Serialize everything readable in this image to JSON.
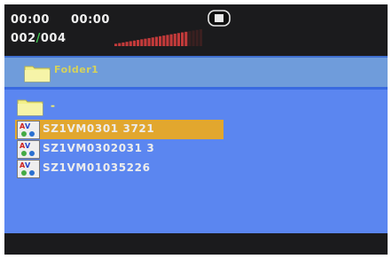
{
  "header": {
    "time_elapsed": "00:00",
    "time_total": "00:00",
    "track_current": "002",
    "track_separator": "/",
    "track_total": "004",
    "volume_level": 0.85,
    "stop_icon": "stop-icon"
  },
  "current_folder": {
    "icon": "folder-icon",
    "name": "Folder1"
  },
  "file_list": {
    "parent_icon": "folder-icon",
    "parent_label": "-",
    "items": [
      {
        "name": "SZ1VM0301 3721",
        "icon": "video-file-icon",
        "selected": true
      },
      {
        "name": "SZ1VM0302031 3",
        "icon": "video-file-icon",
        "selected": false
      },
      {
        "name": "SZ1VM01035226",
        "icon": "video-file-icon",
        "selected": false
      }
    ]
  },
  "colors": {
    "screen_bg": "#5b86f0",
    "bar_bg": "#1b1b1d",
    "folder_bar_bg": "#6f9cdb",
    "selection": "#e2a72e",
    "folder": "#f2f08a",
    "volume": "#c23a3a"
  }
}
